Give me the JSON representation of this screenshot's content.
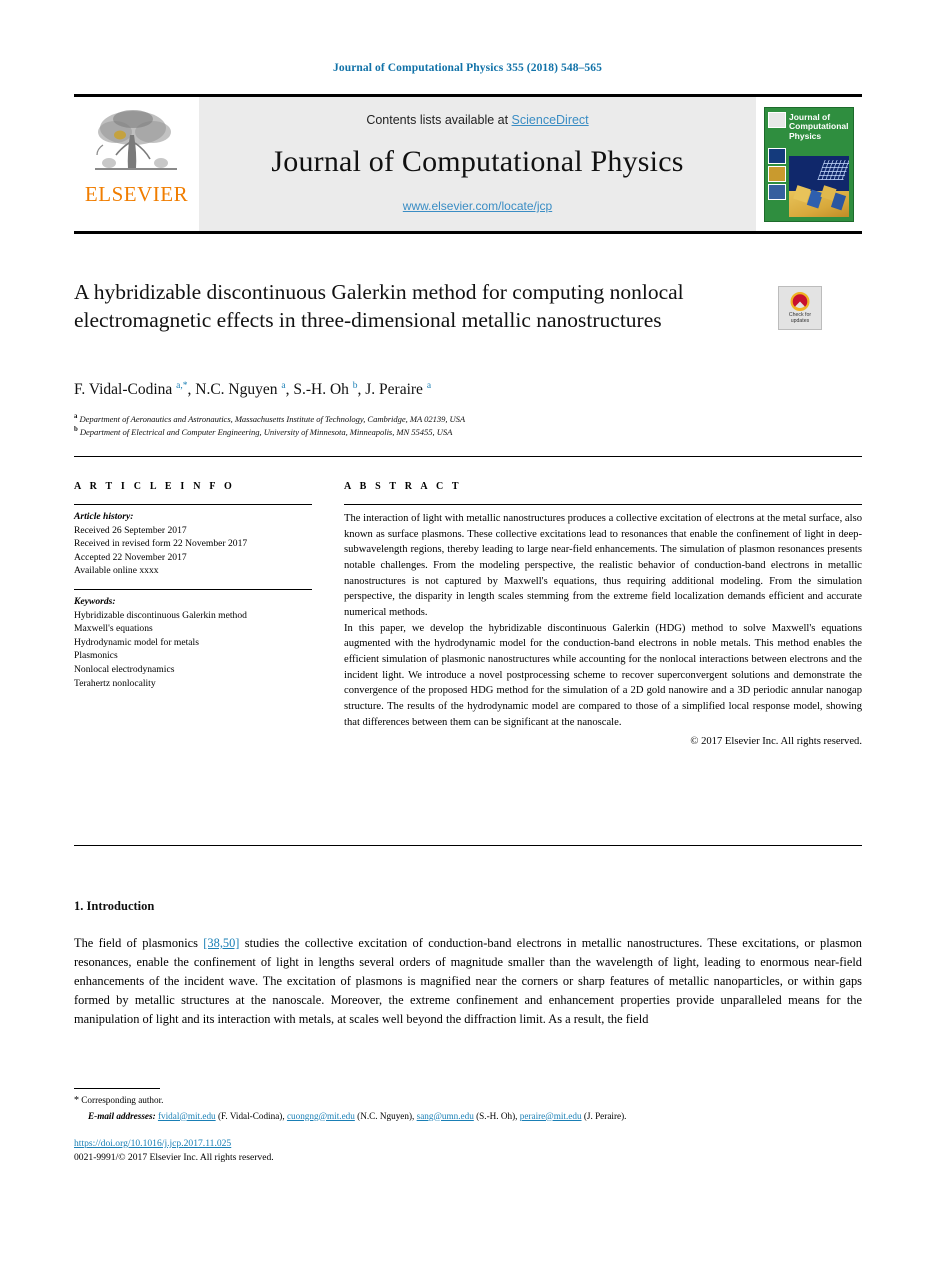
{
  "running_head": "Journal of Computational Physics 355 (2018) 548–565",
  "masthead": {
    "publisher_name": "ELSEVIER",
    "contents_prefix": "Contents lists available at ",
    "sciencedirect": "ScienceDirect",
    "journal_title": "Journal of Computational Physics",
    "journal_url": "www.elsevier.com/locate/jcp",
    "cover_title": "Journal of Computational Physics",
    "accent_orange": "#f07d00",
    "link_blue": "#3a8dc4",
    "cover_green": "#2f8e3f"
  },
  "article": {
    "title": "A hybridizable discontinuous Galerkin method for computing nonlocal electromagnetic effects in three-dimensional metallic nanostructures",
    "crossmark_label_line1": "Check for",
    "crossmark_label_line2": "updates",
    "authors_html": "F. Vidal-Codina <sup>a,*</sup>, N.C. Nguyen <sup>a</sup>, S.-H. Oh <sup>b</sup>, J. Peraire <sup>a</sup>",
    "affiliation_a_marker": "a",
    "affiliation_a": "Department of Aeronautics and Astronautics, Massachusetts Institute of Technology, Cambridge, MA 02139, USA",
    "affiliation_b_marker": "b",
    "affiliation_b": "Department of Electrical and Computer Engineering, University of Minnesota, Minneapolis, MN 55455, USA"
  },
  "headings": {
    "article_info": "A R T I C L E   I N F O",
    "abstract": "A B S T R A C T",
    "introduction": "1. Introduction"
  },
  "article_info": {
    "history_label": "Article history:",
    "history": [
      "Received 26 September 2017",
      "Received in revised form 22 November 2017",
      "Accepted 22 November 2017",
      "Available online xxxx"
    ],
    "keywords_label": "Keywords:",
    "keywords": [
      "Hybridizable discontinuous Galerkin method",
      "Maxwell's equations",
      "Hydrodynamic model for metals",
      "Plasmonics",
      "Nonlocal electrodynamics",
      "Terahertz nonlocality"
    ]
  },
  "abstract": {
    "paragraph_1": "The interaction of light with metallic nanostructures produces a collective excitation of electrons at the metal surface, also known as surface plasmons. These collective excitations lead to resonances that enable the confinement of light in deep-subwavelength regions, thereby leading to large near-field enhancements. The simulation of plasmon resonances presents notable challenges. From the modeling perspective, the realistic behavior of conduction-band electrons in metallic nanostructures is not captured by Maxwell's equations, thus requiring additional modeling. From the simulation perspective, the disparity in length scales stemming from the extreme field localization demands efficient and accurate numerical methods.",
    "paragraph_2": "In this paper, we develop the hybridizable discontinuous Galerkin (HDG) method to solve Maxwell's equations augmented with the hydrodynamic model for the conduction-band electrons in noble metals. This method enables the efficient simulation of plasmonic nanostructures while accounting for the nonlocal interactions between electrons and the incident light. We introduce a novel postprocessing scheme to recover superconvergent solutions and demonstrate the convergence of the proposed HDG method for the simulation of a 2D gold nanowire and a 3D periodic annular nanogap structure. The results of the hydrodynamic model are compared to those of a simplified local response model, showing that differences between them can be significant at the nanoscale.",
    "copyright": "© 2017 Elsevier Inc. All rights reserved."
  },
  "introduction": {
    "part_1": "The field of plasmonics ",
    "citation": "[38,50]",
    "part_2": " studies the collective excitation of conduction-band electrons in metallic nanostructures. These excitations, or plasmon resonances, enable the confinement of light in lengths several orders of magnitude smaller than the wavelength of light, leading to enormous near-field enhancements of the incident wave. The excitation of plasmons is magnified near the corners or sharp features of metallic nanoparticles, or within gaps formed by metallic structures at the nanoscale. Moreover, the extreme confinement and enhancement properties provide unparalleled means for the manipulation of light and its interaction with metals, at scales well beyond the diffraction limit. As a result, the field"
  },
  "footnote": {
    "corresponding": "Corresponding author.",
    "email_label": "E-mail addresses:",
    "emails": [
      {
        "address": "fvidal@mit.edu",
        "owner": "(F. Vidal-Codina)"
      },
      {
        "address": "cuongng@mit.edu",
        "owner": "(N.C. Nguyen)"
      },
      {
        "address": "sang@umn.edu",
        "owner": "(S.-H. Oh)"
      },
      {
        "address": "peraire@mit.edu",
        "owner": "(J. Peraire)"
      }
    ],
    "doi": "https://doi.org/10.1016/j.jcp.2017.11.025",
    "issn_line": "0021-9991/© 2017 Elsevier Inc. All rights reserved."
  }
}
